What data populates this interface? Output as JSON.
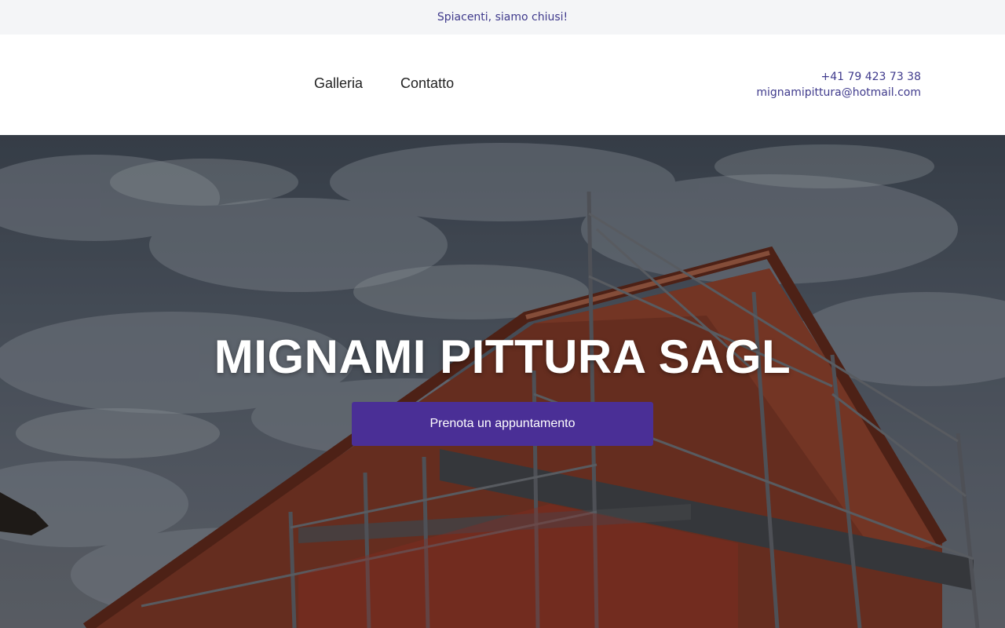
{
  "notice": {
    "text": "Spiacenti, siamo chiusi!"
  },
  "nav": {
    "items": [
      {
        "label": "Galleria"
      },
      {
        "label": "Contatto"
      }
    ]
  },
  "contact": {
    "phone": "+41 79 423 73 38",
    "email": "mignamipittura@hotmail.com"
  },
  "hero": {
    "title": "MIGNAMI PITTURA SAGL",
    "cta_label": "Prenota un appuntamento",
    "background_image": "building-with-scaffolding-photo"
  },
  "colors": {
    "accent": "#4a2f96",
    "link": "#3f3a8c",
    "notice_bg": "#f4f5f7"
  }
}
